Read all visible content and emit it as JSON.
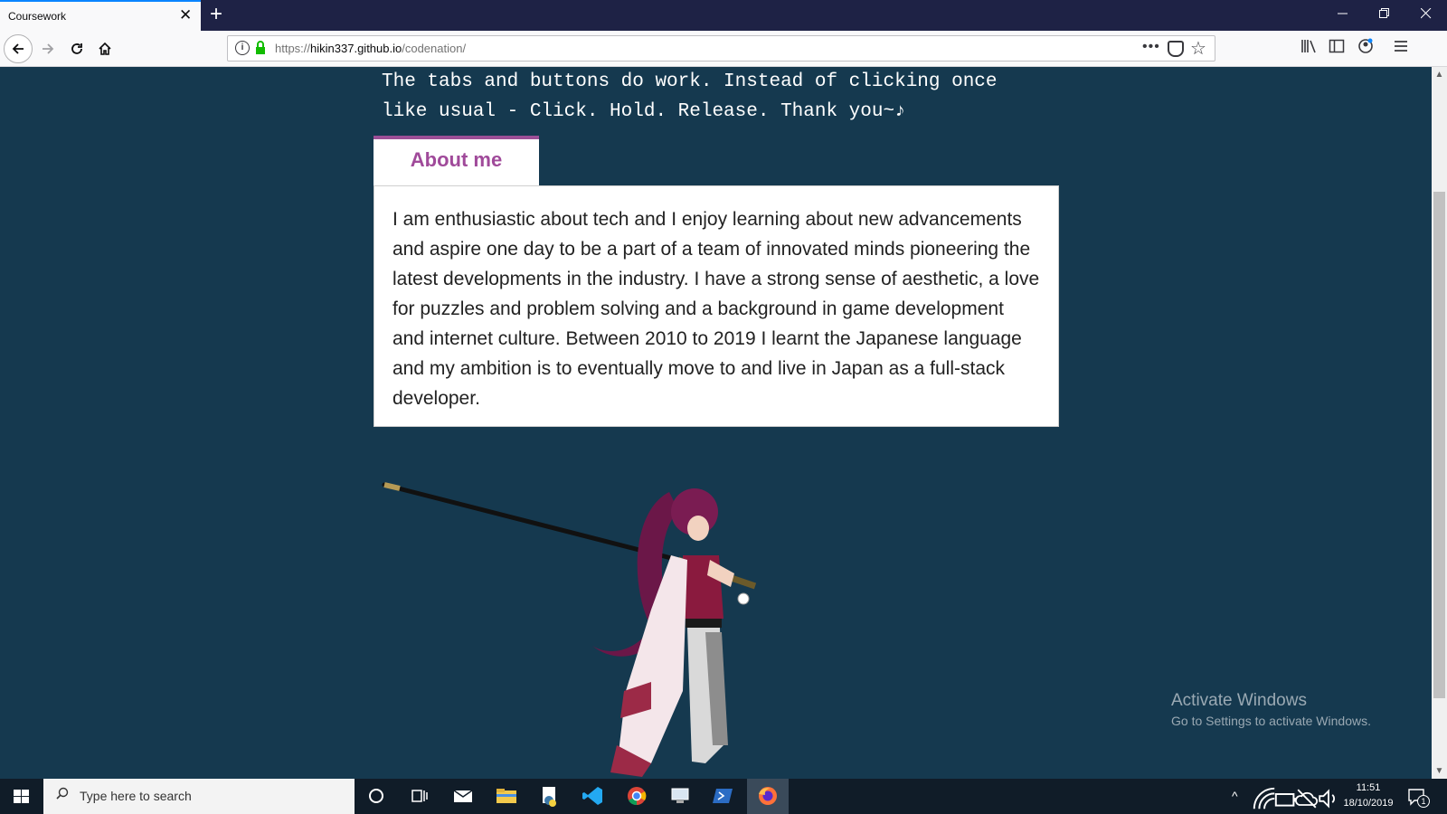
{
  "browser": {
    "tab_title": "Coursework",
    "tab_close": "✕",
    "new_tab": "+",
    "url_scheme": "https://",
    "url_host": "hikin337.github.io",
    "url_path": "/codenation/",
    "url_more": "•••"
  },
  "page": {
    "intro_line1": "The tabs and buttons do work. Instead of clicking once",
    "intro_line2": "like usual - Click. Hold. Release. Thank you~♪",
    "tab_label": "About me",
    "about_text": "I am enthusiastic about tech and I enjoy learning about new advancements and aspire one day to be a part of a team of innovated minds pioneering the latest developments in the industry. I have a strong sense of aesthetic, a love for puzzles and problem solving and a background in game development and internet culture. Between 2010 to 2019 I learnt the Japanese language and my ambition is to eventually move to and live in Japan as a full-stack developer."
  },
  "watermark": {
    "title": "Activate Windows",
    "subtitle": "Go to Settings to activate Windows."
  },
  "taskbar": {
    "search_placeholder": "Type here to search",
    "time": "11:51",
    "date": "18/10/2019",
    "notification_count": "1"
  },
  "colors": {
    "page_bg": "#15394f",
    "tab_accent": "#9b4f96",
    "tab_text": "#a04a9a",
    "taskbar_bg": "#101c28",
    "titlebar_bg": "#1e2245"
  }
}
